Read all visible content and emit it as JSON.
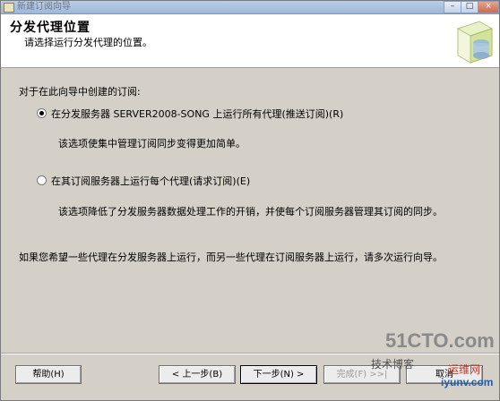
{
  "window": {
    "title": "新建订阅向导",
    "controls": {
      "minimize": "–",
      "maximize": "□",
      "close": "×"
    }
  },
  "header": {
    "title": "分发代理位置",
    "subtitle": "请选择运行分发代理的位置。"
  },
  "content": {
    "prompt": "对于在此向导中创建的订阅:",
    "options": [
      {
        "label": "在分发服务器 SERVER2008-SONG 上运行所有代理(推送订阅)(R)",
        "description": "该选项使集中管理订阅同步变得更加简单。",
        "selected": true
      },
      {
        "label": "在其订阅服务器上运行每个代理(请求订阅)(E)",
        "description": "该选项降低了分发服务器数据处理工作的开销，并使每个订阅服务器管理其订阅的同步。",
        "selected": false
      }
    ],
    "note": "如果您希望一些代理在分发服务器上运行，而另一些代理在订阅服务器上运行，请多次运行向导。"
  },
  "buttons": {
    "help": "帮助(H)",
    "back": "< 上一步(B)",
    "next": "下一步(N) >",
    "finish": "完成(F) >>|",
    "cancel": "取消"
  },
  "watermark": {
    "brand": "51CTO.com",
    "tagline": "技术博客",
    "red_text": "运维网",
    "domain": "iyunv.com"
  }
}
